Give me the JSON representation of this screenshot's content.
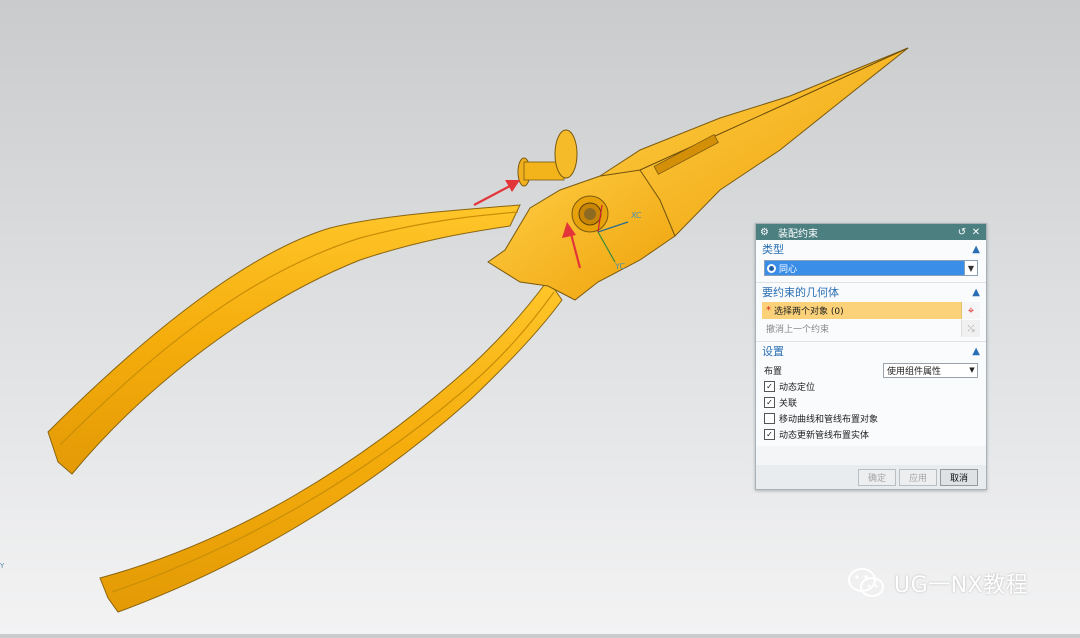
{
  "viewport": {
    "colors": {
      "part": "#f5b10f",
      "part_edge": "#7a5a10",
      "arrow": "#e3343a"
    },
    "triad_labels": {
      "x": "XC",
      "y": "YC"
    },
    "corner_label": "Y"
  },
  "dialog": {
    "title": "装配约束",
    "sections": {
      "type": {
        "label": "类型",
        "selected": "同心"
      },
      "geometry": {
        "label": "要约束的几何体",
        "select_row": "选择两个对象 (0)",
        "undo_row": "撤消上一个约束"
      },
      "settings": {
        "label": "设置",
        "layout_label": "布置",
        "layout_value": "使用组件属性",
        "checkboxes": [
          {
            "label": "动态定位",
            "checked": true
          },
          {
            "label": "关联",
            "checked": true
          },
          {
            "label": "移动曲线和管线布置对象",
            "checked": false
          },
          {
            "label": "动态更新管线布置实体",
            "checked": true
          }
        ]
      }
    },
    "buttons": {
      "ok": "确定",
      "apply": "应用",
      "cancel": "取消"
    }
  },
  "watermark": {
    "text": "UG一NX教程"
  }
}
